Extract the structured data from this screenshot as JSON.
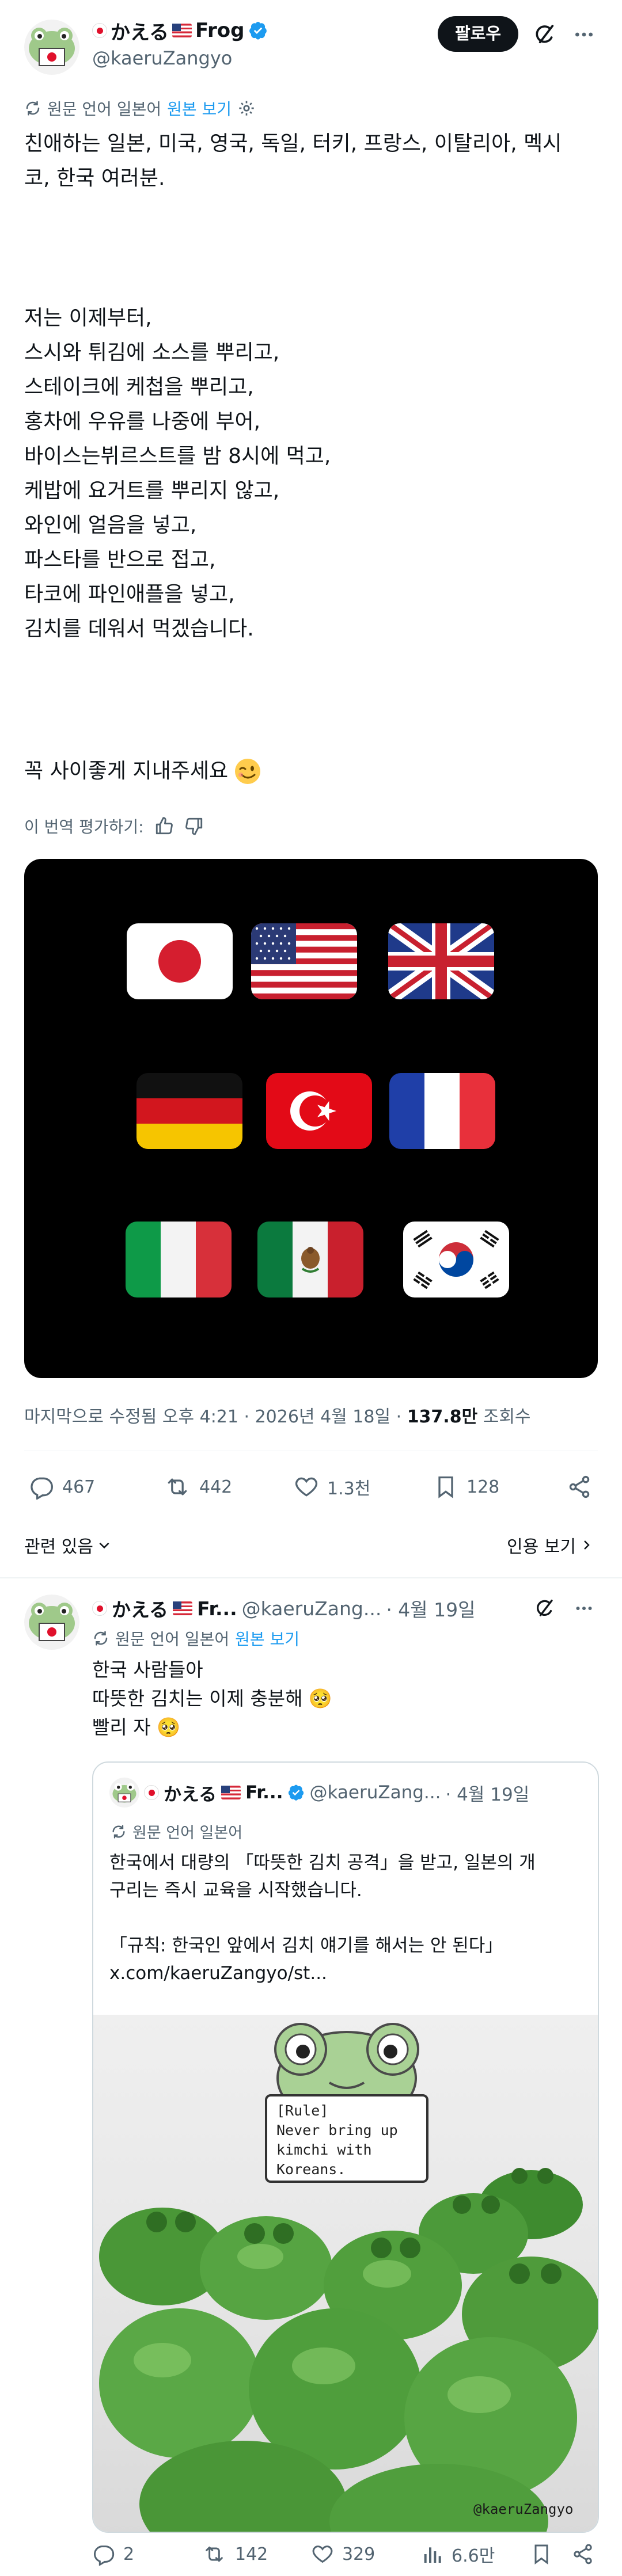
{
  "post": {
    "display_name": "かえる",
    "display_name_suffix": "Frog",
    "handle": "@kaeruZangyo",
    "follow_label": "팔로우",
    "translation": {
      "note": "원문 언어 일본어",
      "view_original": "원본 보기"
    },
    "text_intro": "친애하는 일본, 미국, 영국, 독일, 터키, 프랑스, 이탈리아, 멕시\n코, 한국 여러분.",
    "text_body": "저는 이제부터,\n스시와 튀김에 소스를 뿌리고,\n스테이크에 케첩을 뿌리고,\n홍차에 우유를 나중에 부어,\n바이스는뷔르스트를 밤 8시에 먹고,\n케밥에 요거트를 뿌리지 않고,\n와인에 얼음을 넣고,\n파스타를 반으로 접고,\n타코에 파인애플을 넣고,\n김치를 데워서 먹겠습니다.",
    "text_closing": "꼭 사이좋게 지내주세요",
    "rate_translation": "이 번역 평가하기:",
    "meta": {
      "edited": "마지막으로 수정됨 오후 4:21 · 2026년 4월 18일 · ",
      "views_count": "137.8만",
      "views_label": " 조회수"
    },
    "actions": {
      "replies": "467",
      "reposts": "442",
      "likes": "1.3천",
      "bookmarks": "128"
    },
    "related_label": "관련 있음",
    "quotes_label": "인용 보기"
  },
  "reply": {
    "display_name": "かえる",
    "display_name_suffix": "Fr...",
    "handle": "@kaeruZang...",
    "date": "· 4월 19일",
    "translation_note": "원문 언어 일본어",
    "view_original": "원본 보기",
    "text": "한국 사람들아\n따뜻한 김치는 이제 충분해 🥺\n빨리 자 🥺",
    "quote": {
      "display_name": "かえる",
      "display_name_suffix": "Fr...",
      "handle": "@kaeruZang...",
      "date": "· 4월 19일",
      "translation_note": "원문 언어 일본어",
      "text": "한국에서 대량의 「따뜻한 김치 공격」을 받고, 일본의 개\n구리는 즉시 교육을 시작했습니다.\n\n「규칙: 한국인 앞에서 김치 얘기를 해서는 안 된다」\nx.com/kaeruZangyo/st...",
      "sign_line1": "[Rule]",
      "sign_line2": "Never bring up",
      "sign_line3": "kimchi with",
      "sign_line4": "Koreans.",
      "watermark": "@kaeruZangyo"
    },
    "actions": {
      "replies": "2",
      "reposts": "142",
      "likes": "329",
      "views": "6.6만"
    }
  },
  "colors": {
    "accent": "#1d9bf0",
    "muted": "#536471",
    "divider": "#eff3f4"
  }
}
